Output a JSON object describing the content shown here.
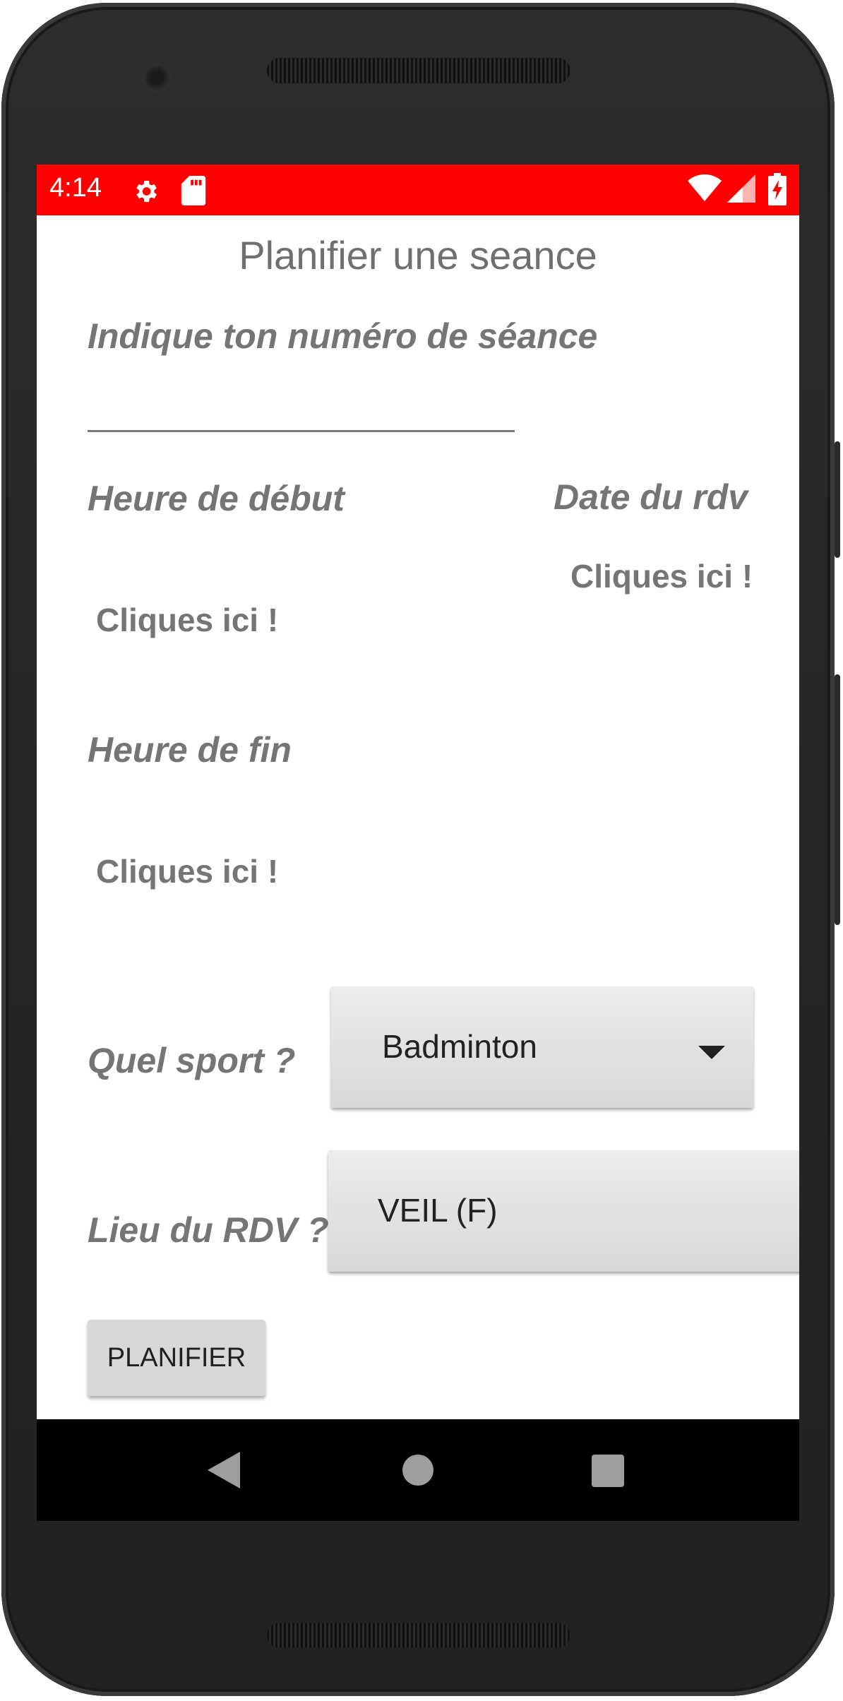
{
  "status_bar": {
    "time": "4:14",
    "color": "#ff0000",
    "icons": [
      "settings-icon",
      "sd-card-icon",
      "wifi-icon",
      "signal-icon",
      "battery-charging-icon"
    ]
  },
  "page": {
    "title": "Planifier une seance"
  },
  "form": {
    "session_number_label": "Indique ton numéro de séance",
    "session_number_value": "",
    "start_time_label": "Heure de début",
    "start_time_action": "Cliques ici !",
    "date_label": "Date du rdv",
    "date_action": "Cliques ici !",
    "end_time_label": "Heure de fin",
    "end_time_action": "Cliques ici !",
    "sport_label": "Quel sport ?",
    "sport_selected": "Badminton",
    "place_label": "Lieu du RDV ?",
    "place_selected": "VEIL (F)",
    "submit_label": "PLANIFIER"
  },
  "nav_bar": {
    "icons": [
      "back-icon",
      "home-icon",
      "recents-icon"
    ]
  }
}
